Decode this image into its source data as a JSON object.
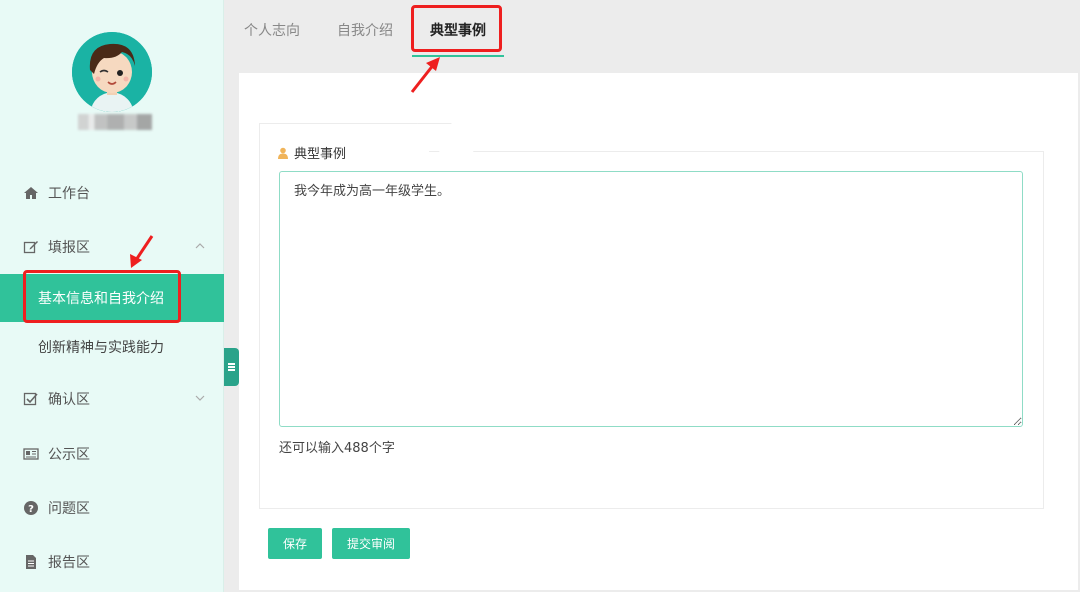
{
  "sidebar": {
    "nav": [
      {
        "label": "工作台",
        "icon": "home-icon"
      },
      {
        "label": "填报区",
        "icon": "edit-icon"
      },
      {
        "label": "确认区",
        "icon": "checkbox-icon"
      },
      {
        "label": "公示区",
        "icon": "newspaper-icon"
      },
      {
        "label": "问题区",
        "icon": "question-circle-icon"
      },
      {
        "label": "报告区",
        "icon": "file-icon"
      }
    ],
    "subitems": [
      {
        "label": "基本信息和自我介绍",
        "active": true
      },
      {
        "label": "创新精神与实践能力",
        "active": false
      }
    ]
  },
  "tabs": [
    {
      "label": "个人志向"
    },
    {
      "label": "自我介绍"
    },
    {
      "label": "典型事例"
    }
  ],
  "section": {
    "title": "典型事例",
    "textarea_value": "我今年成为高一年级学生。",
    "counter_text": "还可以输入488个字"
  },
  "buttons": {
    "save": "保存",
    "submit": "提交审阅"
  },
  "colors": {
    "accent": "#30c29a",
    "sidebar_bg": "#e8faf6",
    "annotation_red": "#ee1f1f"
  }
}
